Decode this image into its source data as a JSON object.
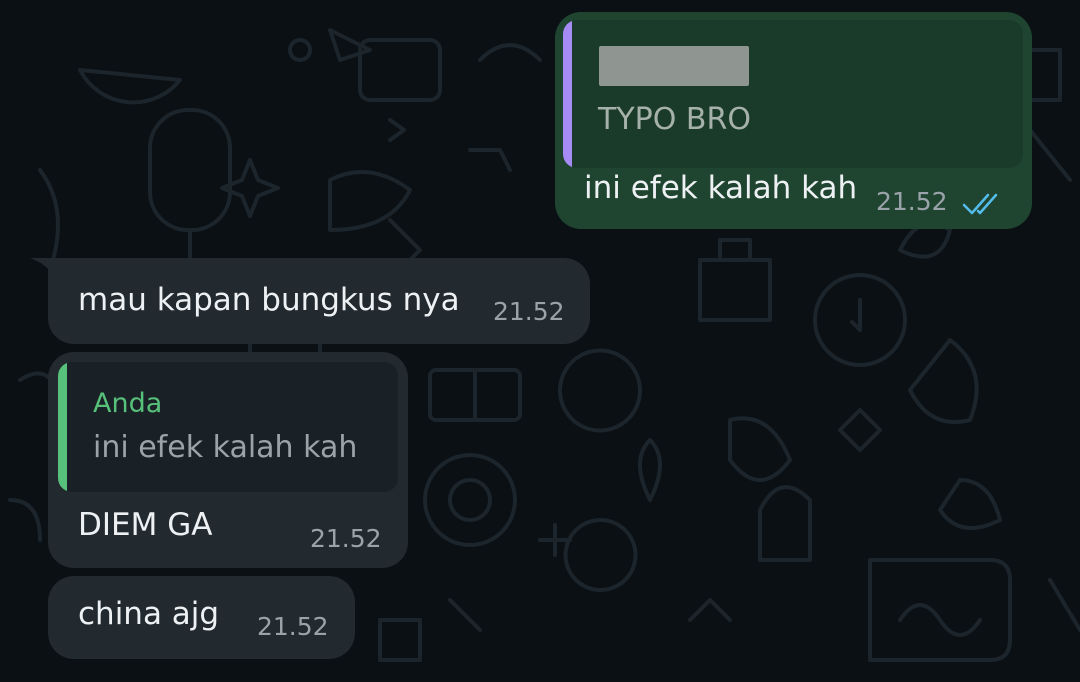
{
  "colors": {
    "chat_background": "#0b1014",
    "outgoing_bubble": "#1f4530",
    "incoming_bubble": "#222a30",
    "outgoing_quote_bg": "#1a3b29",
    "incoming_quote_bg": "#1a2126",
    "quote_bar_purple": "#a78bf5",
    "quote_bar_green": "#57c07a",
    "read_ticks": "#53bdeb",
    "time_text": "#9aa3a9"
  },
  "messages": [
    {
      "direction": "outgoing",
      "quote": {
        "sender_redacted": true,
        "text": "TYPO BRO"
      },
      "text": "ini efek kalah kah",
      "time": "21.52",
      "status_icon": "double-check-read-icon"
    },
    {
      "direction": "incoming",
      "text": "mau kapan bungkus nya",
      "time": "21.52"
    },
    {
      "direction": "incoming",
      "quote": {
        "sender": "Anda",
        "text": "ini efek kalah kah"
      },
      "text": "DIEM GA",
      "time": "21.52"
    },
    {
      "direction": "incoming",
      "text": "china ajg",
      "time": "21.52"
    }
  ]
}
